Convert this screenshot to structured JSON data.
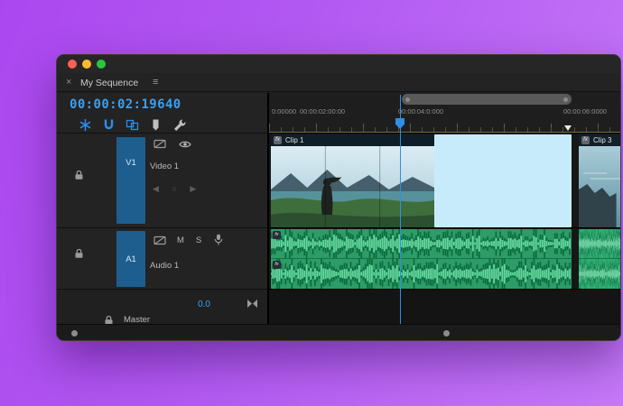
{
  "tab": {
    "close_glyph": "×",
    "title": "My Sequence",
    "menu_glyph": "≡"
  },
  "timecode": "00:00:02:19640",
  "toolbar": {
    "icons": [
      "nest",
      "snap",
      "linked-selection",
      "add-marker",
      "timeline-settings"
    ]
  },
  "ruler": {
    "labels": [
      "0:00000",
      "00:00:02:00:00",
      "00:00:04:0:000",
      "00:00:06:0000"
    ]
  },
  "tracks": {
    "video": {
      "target": "V1",
      "name": "Video 1",
      "nav_prev": "◀",
      "nav_dot": "○",
      "nav_next": "▶"
    },
    "audio": {
      "target": "A1",
      "name": "Audio 1",
      "mute": "M",
      "solo": "S"
    },
    "master": {
      "name": "Master",
      "level": "0.0"
    }
  },
  "clips": {
    "clip1": {
      "fx": "fx",
      "name": "Clip 1"
    },
    "clip3": {
      "fx": "fx",
      "name": "Clip 3"
    }
  },
  "colors": {
    "accent_blue": "#2d8ceb",
    "timecode_blue": "#3aa0f2",
    "track_target_blue": "#1d5e8e",
    "audio_green": "#2d9c66",
    "selection_cyan": "#c8ebfb",
    "traffic_red": "#ff5f57",
    "traffic_yellow": "#febc2e",
    "traffic_green": "#29c73f"
  }
}
